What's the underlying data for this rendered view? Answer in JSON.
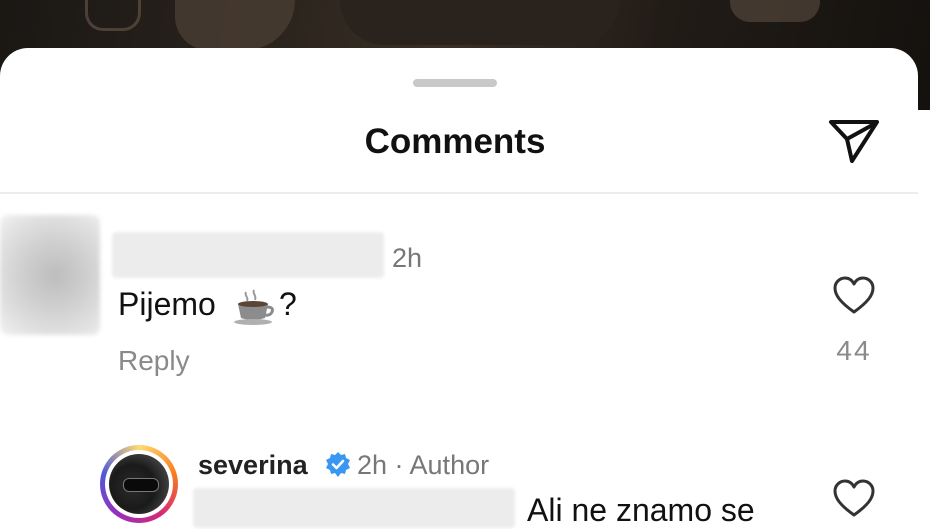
{
  "header": {
    "title": "Comments",
    "send_icon": "send-paper-plane-icon"
  },
  "comments": [
    {
      "time": "2h",
      "text": "Pijemo",
      "emoji": "coffee-cup",
      "text_suffix": "?",
      "reply_label": "Reply",
      "likes": "44"
    }
  ],
  "replies": [
    {
      "username": "severina",
      "verified": true,
      "meta": "2h · Author",
      "text": "Ali ne znamo se"
    }
  ],
  "colors": {
    "accent_blue": "#3897f0",
    "muted_text": "#8a8a8a",
    "primary_text": "#111111"
  }
}
